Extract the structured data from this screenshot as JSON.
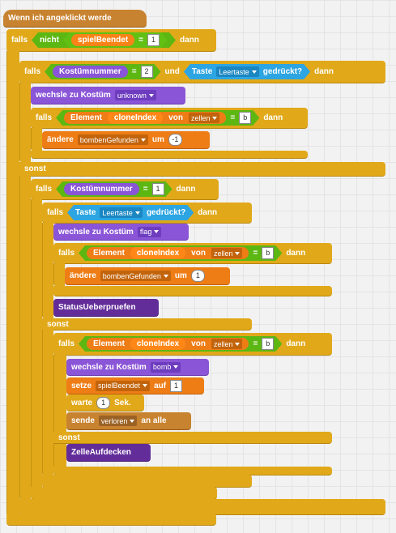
{
  "hat": {
    "label": "Wenn ich angeklickt werde"
  },
  "if1": {
    "falls": "falls",
    "not": "nicht",
    "var": "spielBeendet",
    "eq": "=",
    "value": "1",
    "dann": "dann"
  },
  "if2": {
    "falls": "falls",
    "var": "Kostümnummer",
    "eq": "=",
    "value": "2",
    "and": "und",
    "key_label": "Taste",
    "key": "Leertaste",
    "pressed": "gedrückt?",
    "dann": "dann"
  },
  "switch1": {
    "label": "wechsle zu Kostüm",
    "costume": "unknown"
  },
  "if3": {
    "falls": "falls",
    "element": "Element",
    "index": "cloneIndex",
    "von": "von",
    "list": "zellen",
    "eq": "=",
    "value": "b",
    "dann": "dann"
  },
  "change1": {
    "label": "ändere",
    "var": "bombenGefunden",
    "um": "um",
    "value": "-1"
  },
  "sonst1": "sonst",
  "if4": {
    "falls": "falls",
    "var": "Kostümnummer",
    "eq": "=",
    "value": "1",
    "dann": "dann"
  },
  "if5": {
    "falls": "falls",
    "key_label": "Taste",
    "key": "Leertaste",
    "pressed": "gedrückt?",
    "dann": "dann"
  },
  "switch2": {
    "label": "wechsle zu Kostüm",
    "costume": "flag"
  },
  "if6": {
    "falls": "falls",
    "element": "Element",
    "index": "cloneIndex",
    "von": "von",
    "list": "zellen",
    "eq": "=",
    "value": "b",
    "dann": "dann"
  },
  "change2": {
    "label": "ändere",
    "var": "bombenGefunden",
    "um": "um",
    "value": "1"
  },
  "status": {
    "label": "StatusUeberpruefen"
  },
  "sonst2": "sonst",
  "if7": {
    "falls": "falls",
    "element": "Element",
    "index": "cloneIndex",
    "von": "von",
    "list": "zellen",
    "eq": "=",
    "value": "b",
    "dann": "dann"
  },
  "switch3": {
    "label": "wechsle zu Kostüm",
    "costume": "bomb"
  },
  "set1": {
    "label": "setze",
    "var": "spielBeendet",
    "auf": "auf",
    "value": "1"
  },
  "wait1": {
    "label": "warte",
    "value": "1",
    "unit": "Sek."
  },
  "broadcast": {
    "label": "sende",
    "message": "verloren",
    "suffix": "an alle"
  },
  "sonst3": "sonst",
  "reveal": {
    "label": "ZelleAufdecken"
  },
  "colors": {
    "control": "#e1a91a",
    "events": "#c88330",
    "looks": "#8a55d7",
    "data": "#ee7d16",
    "sensing": "#2ca5e2",
    "operators": "#5cb712"
  }
}
